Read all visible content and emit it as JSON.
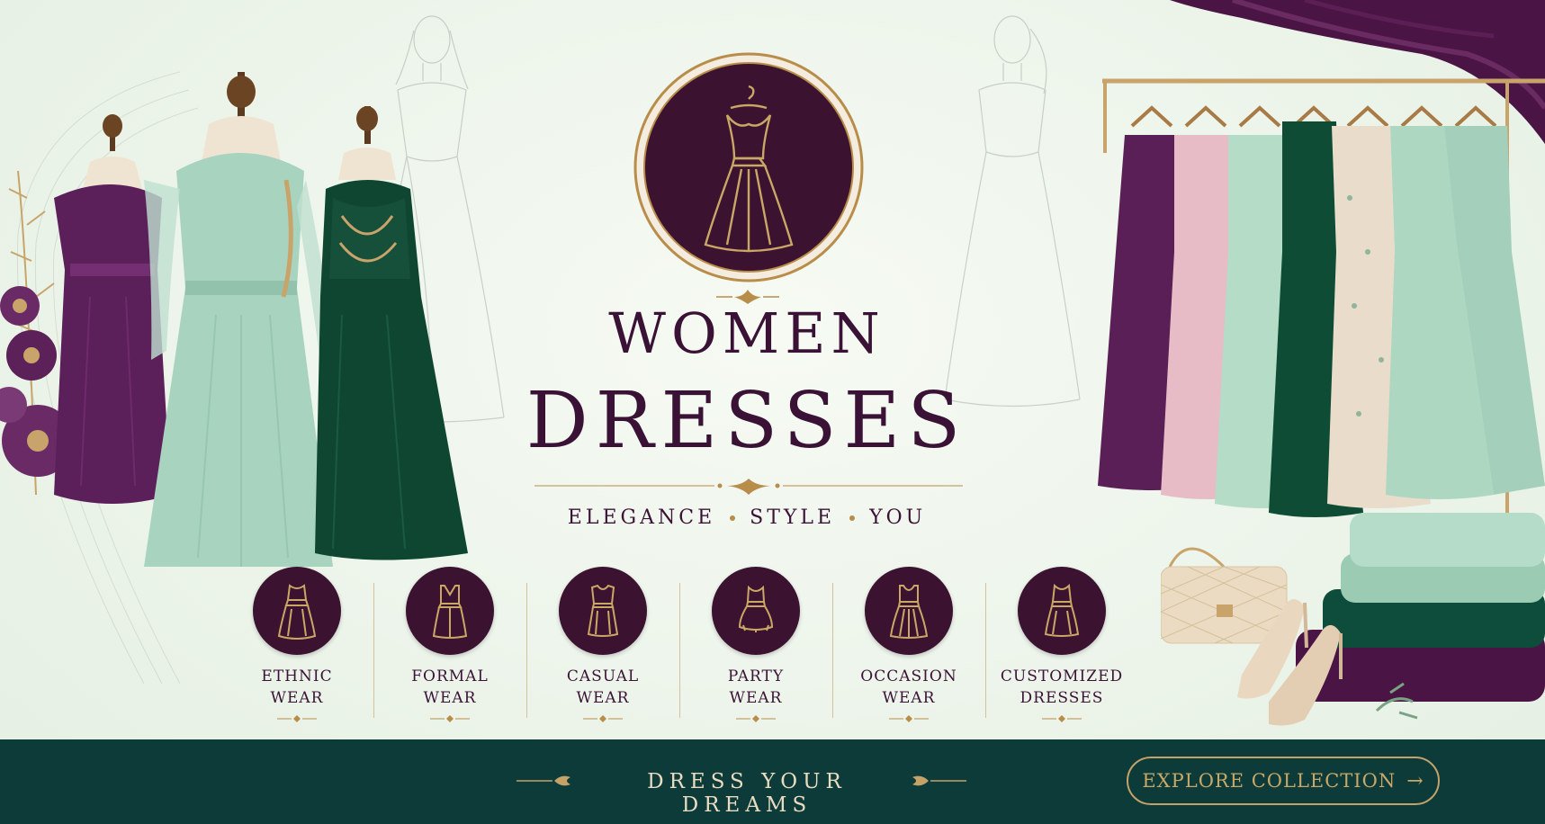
{
  "banner": {
    "title_line1": "WOMEN",
    "title_line2": "DRESSES",
    "tagline": {
      "word1": "ELEGANCE",
      "word2": "STYLE",
      "word3": "YOU"
    }
  },
  "categories": [
    {
      "line1": "ETHNIC",
      "line2": "WEAR",
      "icon": "ethnic-dress-icon"
    },
    {
      "line1": "FORMAL",
      "line2": "WEAR",
      "icon": "formal-dress-icon"
    },
    {
      "line1": "CASUAL",
      "line2": "WEAR",
      "icon": "casual-dress-icon"
    },
    {
      "line1": "PARTY",
      "line2": "WEAR",
      "icon": "party-dress-icon"
    },
    {
      "line1": "OCCASION",
      "line2": "WEAR",
      "icon": "occasion-dress-icon"
    },
    {
      "line1": "CUSTOMIZED",
      "line2": "DRESSES",
      "icon": "customized-dress-icon"
    }
  ],
  "footer": {
    "slogan": "DRESS YOUR DREAMS",
    "cta_label": "EXPLORE COLLECTION",
    "cta_arrow": "→"
  },
  "colors": {
    "plum": "#3b1230",
    "gold": "#c4a268",
    "teal_footer": "#0c3b3a",
    "mint_bg": "#eef5ec"
  }
}
